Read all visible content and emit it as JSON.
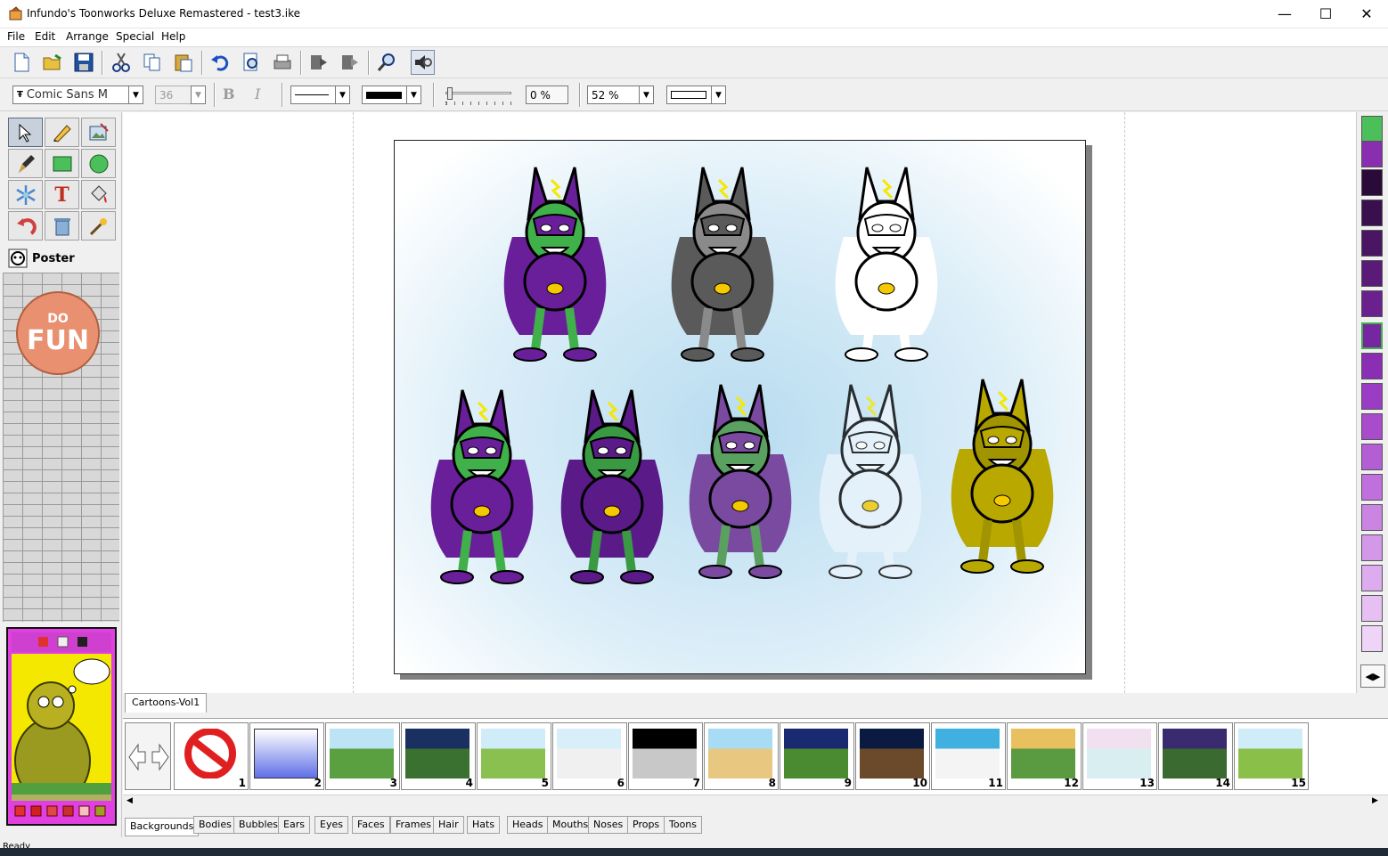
{
  "window": {
    "title": "Infundo's Toonworks Deluxe Remastered - test3.ike"
  },
  "menu": [
    "File",
    "Edit",
    "Arrange",
    "Special",
    "Help"
  ],
  "format": {
    "font": "Comic Sans M",
    "size": "36",
    "bold": "B",
    "italic": "I",
    "transparency": "0 %",
    "zoom": "52 %"
  },
  "tools": {
    "poster_label": "Poster"
  },
  "library": {
    "collection_tab": "Cartoons-Vol1",
    "thumb_numbers": [
      "1",
      "2",
      "3",
      "4",
      "5",
      "6",
      "7",
      "8",
      "9",
      "10",
      "11",
      "12",
      "13",
      "14",
      "15"
    ]
  },
  "categories": [
    "Backgrounds",
    "Bodies",
    "Bubbles",
    "Ears",
    "Eyes",
    "Faces",
    "Frames",
    "Hair",
    "Hats",
    "Heads",
    "Mouths",
    "Noses",
    "Props",
    "Toons"
  ],
  "status": {
    "text": "Ready"
  },
  "colors": {
    "palette_top": "#4bbf5a",
    "palette_second": "#8a2eb0",
    "purple": "#6a1f9a",
    "green": "#3fb04a",
    "gold": "#b8a800"
  }
}
